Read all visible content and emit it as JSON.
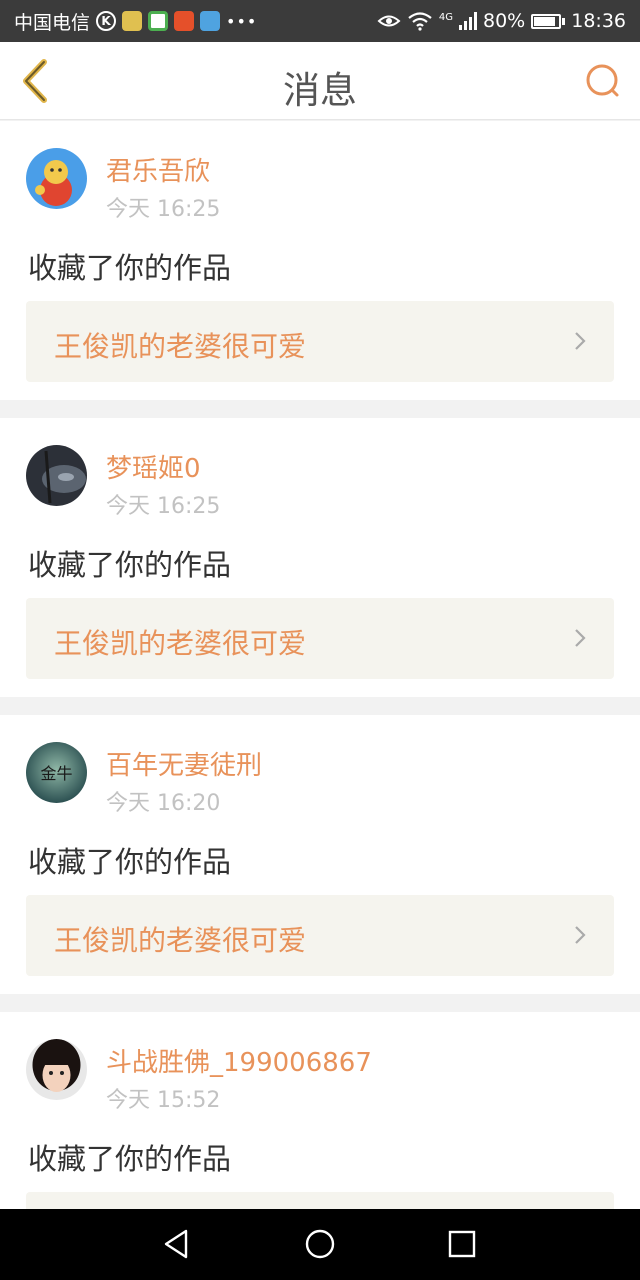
{
  "status_bar": {
    "carrier": "中国电信",
    "network": "4G",
    "battery": "80%",
    "battery_level": 0.8,
    "time": "18:36"
  },
  "header": {
    "title": "消息",
    "back_icon": "chevron-left-icon",
    "search_icon": "search-icon"
  },
  "colors": {
    "accent": "#e8925a",
    "card_link_bg": "#f5f4ee",
    "page_bg": "#f2f2f2"
  },
  "messages": [
    {
      "user": "君乐吾欣",
      "time": "今天 16:25",
      "action": "收藏了你的作品",
      "work": "王俊凯的老婆很可爱"
    },
    {
      "user": "梦瑶姬0",
      "time": "今天 16:25",
      "action": "收藏了你的作品",
      "work": "王俊凯的老婆很可爱"
    },
    {
      "user": "百年无妻徒刑",
      "time": "今天 16:20",
      "action": "收藏了你的作品",
      "work": "王俊凯的老婆很可爱"
    },
    {
      "user": "斗战胜佛_199006867",
      "time": "今天 15:52",
      "action": "收藏了你的作品",
      "work": ""
    }
  ],
  "avatar_text": "金牛"
}
